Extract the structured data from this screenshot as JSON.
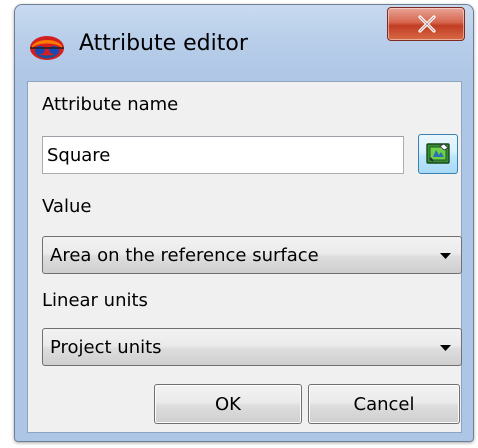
{
  "window": {
    "title": "Attribute editor",
    "icon": "colored-globe-icon",
    "close_icon": "close-x-icon",
    "accent_color": "#c8daf0",
    "close_color": "#c13d24"
  },
  "form": {
    "attribute_name_label": "Attribute name",
    "attribute_name_value": "Square",
    "pick_icon": "pick-attribute-icon",
    "value_label": "Value",
    "value_selected": "Area on the reference surface",
    "linear_units_label": "Linear units",
    "linear_units_selected": "Project units"
  },
  "buttons": {
    "ok_label": "OK",
    "cancel_label": "Cancel"
  }
}
